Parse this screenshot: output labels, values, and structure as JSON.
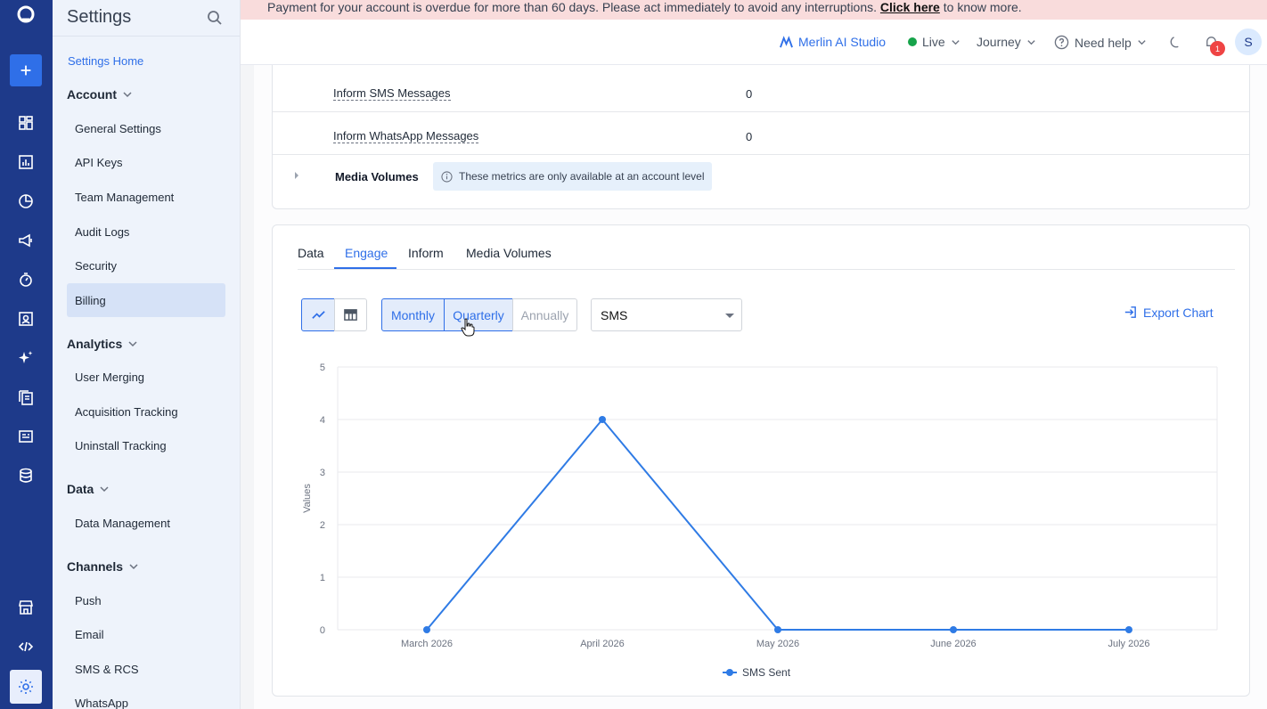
{
  "banner": {
    "message": "Payment for your account is overdue for more than 60 days. Please act immediately to avoid any interruptions.",
    "link_text": "Click here",
    "suffix": "to know more."
  },
  "sidebar": {
    "title": "Settings",
    "home_link": "Settings Home",
    "sections": {
      "account": "Account",
      "analytics": "Analytics",
      "data": "Data",
      "channels": "Channels"
    },
    "items": {
      "general_settings": "General Settings",
      "api_keys": "API Keys",
      "team_management": "Team Management",
      "audit_logs": "Audit Logs",
      "security": "Security",
      "billing": "Billing",
      "user_merging": "User Merging",
      "acquisition_tracking": "Acquisition Tracking",
      "uninstall_tracking": "Uninstall Tracking",
      "data_management": "Data Management",
      "push": "Push",
      "email": "Email",
      "sms_rcs": "SMS & RCS",
      "whatsapp": "WhatsApp"
    }
  },
  "topbar": {
    "merlin": "Merlin AI Studio",
    "environment": "Live",
    "journey": "Journey",
    "help": "Need help",
    "notification_count": "1",
    "avatar_initial": "S"
  },
  "usage_table": {
    "rows": [
      {
        "label": "Inform SMS Messages",
        "value": "0"
      },
      {
        "label": "Inform WhatsApp Messages",
        "value": "0"
      }
    ],
    "media_volumes_title": "Media Volumes",
    "media_volumes_info": "These metrics are only available at an account level"
  },
  "chart_card": {
    "tabs": [
      "Data",
      "Engage",
      "Inform",
      "Media Volumes"
    ],
    "active_tab": "Engage",
    "periods": [
      "Monthly",
      "Quarterly",
      "Annually"
    ],
    "channel_select": "SMS",
    "export_label": "Export Chart"
  },
  "chart_data": {
    "type": "line",
    "categories": [
      "March 2026",
      "April 2026",
      "May 2026",
      "June 2026",
      "July 2026"
    ],
    "series": [
      {
        "name": "SMS Sent",
        "values": [
          0,
          4,
          0,
          0,
          0
        ],
        "color": "#2f7be5"
      }
    ],
    "ylabel": "Values",
    "ylim": [
      0,
      5
    ],
    "yticks": [
      0,
      1,
      2,
      3,
      4,
      5
    ],
    "grid": true,
    "legend": "bottom"
  }
}
